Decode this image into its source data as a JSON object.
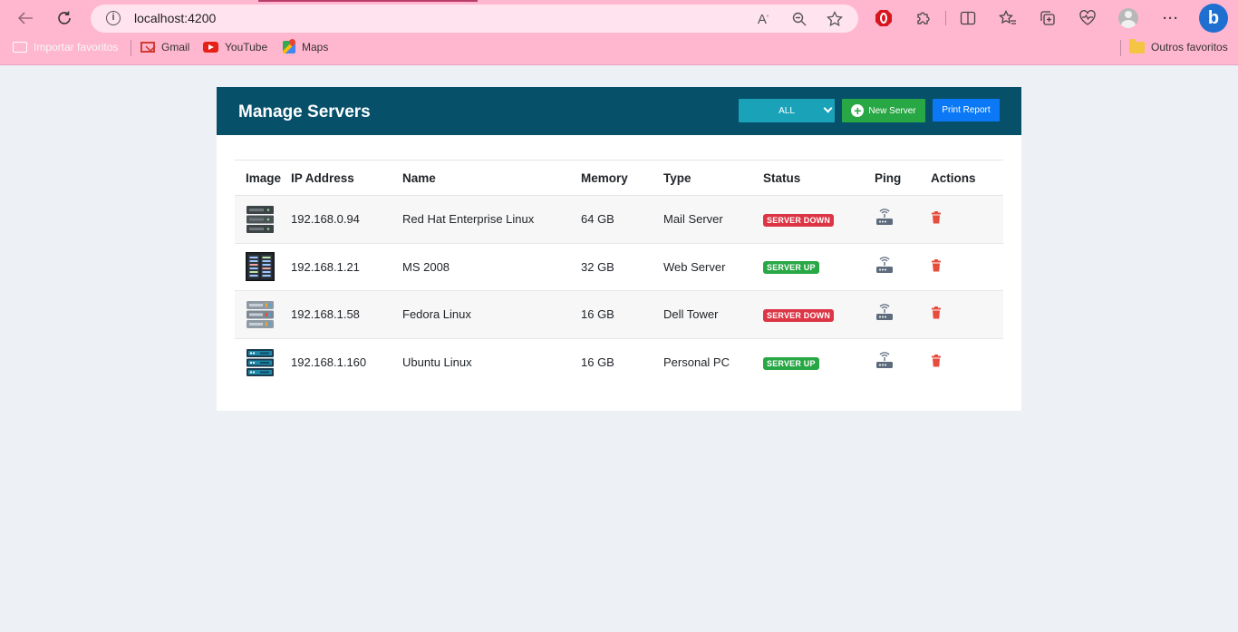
{
  "browser": {
    "url": "localhost:4200",
    "bookmarks": [
      {
        "label": "Importar favoritos",
        "icon": "import-icon"
      },
      {
        "label": "Gmail",
        "icon": "gmail-icon"
      },
      {
        "label": "YouTube",
        "icon": "youtube-icon"
      },
      {
        "label": "Maps",
        "icon": "maps-icon"
      }
    ],
    "other_favorites": "Outros favoritos",
    "bing_label": "b"
  },
  "header": {
    "title": "Manage Servers",
    "filter_value": "ALL",
    "new_server_label": "New Server",
    "print_report_label": "Print Report"
  },
  "table": {
    "columns": [
      "Image",
      "IP Address",
      "Name",
      "Memory",
      "Type",
      "Status",
      "Ping",
      "Actions"
    ],
    "rows": [
      {
        "ip": "192.168.0.94",
        "name": "Red Hat Enterprise Linux",
        "memory": "64 GB",
        "type": "Mail Server",
        "status": "SERVER DOWN",
        "status_kind": "down",
        "image": "server-rack-dark-icon"
      },
      {
        "ip": "192.168.1.21",
        "name": "MS 2008",
        "memory": "32 GB",
        "type": "Web Server",
        "status": "SERVER UP",
        "status_kind": "up",
        "image": "server-panel-icon"
      },
      {
        "ip": "192.168.1.58",
        "name": "Fedora Linux",
        "memory": "16 GB",
        "type": "Dell Tower",
        "status": "SERVER DOWN",
        "status_kind": "down",
        "image": "server-rack-grey-icon"
      },
      {
        "ip": "192.168.1.160",
        "name": "Ubuntu Linux",
        "memory": "16 GB",
        "type": "Personal PC",
        "status": "SERVER UP",
        "status_kind": "up",
        "image": "server-rack-blue-icon"
      }
    ]
  },
  "colors": {
    "header_bg": "#07506a",
    "filter_bg": "#1aa3b8",
    "new_button": "#28a745",
    "print_button": "#0b78f5",
    "status_down": "#dc3545",
    "status_up": "#28a745",
    "delete_icon": "#e74c3c",
    "browser_chrome": "#ffb6cf"
  }
}
